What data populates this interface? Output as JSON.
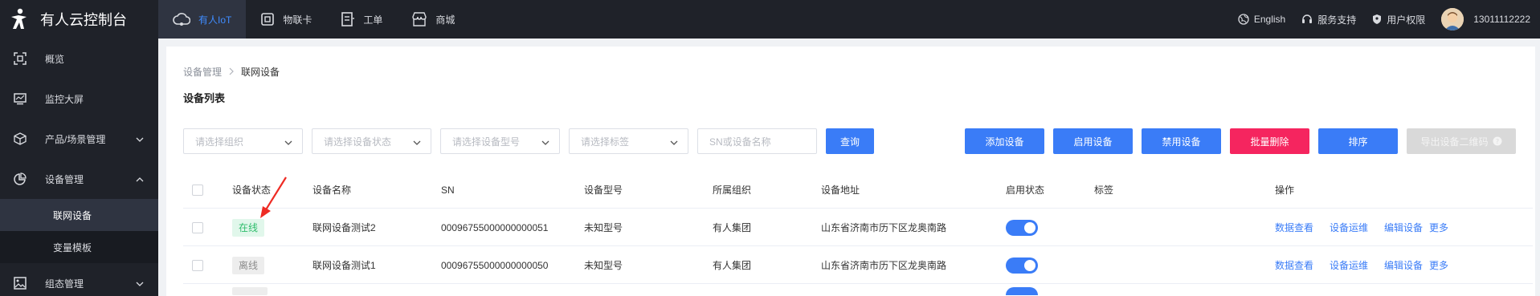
{
  "app": {
    "title": "有人云控制台"
  },
  "topnav": [
    {
      "label": "有人IoT",
      "icon": "cloud-icon",
      "active": true
    },
    {
      "label": "物联卡",
      "icon": "sim-card-icon",
      "active": false
    },
    {
      "label": "工单",
      "icon": "work-order-icon",
      "active": false
    },
    {
      "label": "商城",
      "icon": "store-icon",
      "active": false
    }
  ],
  "topright": {
    "language": "English",
    "support": "服务支持",
    "permission": "用户权限",
    "user": "13011112222"
  },
  "sidebar": {
    "items": [
      {
        "label": "概览",
        "icon": "overview-icon"
      },
      {
        "label": "监控大屏",
        "icon": "monitor-screen-icon"
      },
      {
        "label": "产品/场景管理",
        "icon": "cube-icon"
      },
      {
        "label": "设备管理",
        "icon": "pie-chart-icon"
      },
      {
        "label": "组态管理",
        "icon": "image-icon"
      }
    ],
    "subitems": [
      {
        "label": "联网设备",
        "active": true
      },
      {
        "label": "变量模板",
        "active": false
      }
    ]
  },
  "breadcrumb": {
    "parent": "设备管理",
    "current": "联网设备"
  },
  "page": {
    "title": "设备列表"
  },
  "filters": {
    "org_placeholder": "请选择组织",
    "status_placeholder": "请选择设备状态",
    "model_placeholder": "请选择设备型号",
    "tag_placeholder": "请选择标签",
    "search_placeholder": "SN或设备名称",
    "query_label": "查询"
  },
  "actions": {
    "add": "添加设备",
    "enable": "启用设备",
    "disable": "禁用设备",
    "batch_delete": "批量删除",
    "sort": "排序",
    "export_qr": "导出设备二维码"
  },
  "table": {
    "columns": {
      "status": "设备状态",
      "name": "设备名称",
      "sn": "SN",
      "model": "设备型号",
      "org": "所属组织",
      "address": "设备地址",
      "enabled": "启用状态",
      "tags": "标签",
      "ops": "操作"
    },
    "rows": [
      {
        "status": "在线",
        "name": "联网设备测试2",
        "sn": "00096755000000000051",
        "model": "未知型号",
        "org": "有人集团",
        "address": "山东省济南市历下区龙奥南路",
        "enabled": true
      },
      {
        "status": "离线",
        "name": "联网设备测试1",
        "sn": "00096755000000000050",
        "model": "未知型号",
        "org": "有人集团",
        "address": "山东省济南市历下区龙奥南路",
        "enabled": true
      }
    ],
    "row_actions": {
      "view_data": "数据查看",
      "ops": "设备运维",
      "edit": "编辑设备",
      "more": "更多"
    }
  },
  "colors": {
    "accent": "#3a7cf7",
    "danger": "#f5255f",
    "dark": "#1f2229",
    "online": "#2ebd6b"
  }
}
